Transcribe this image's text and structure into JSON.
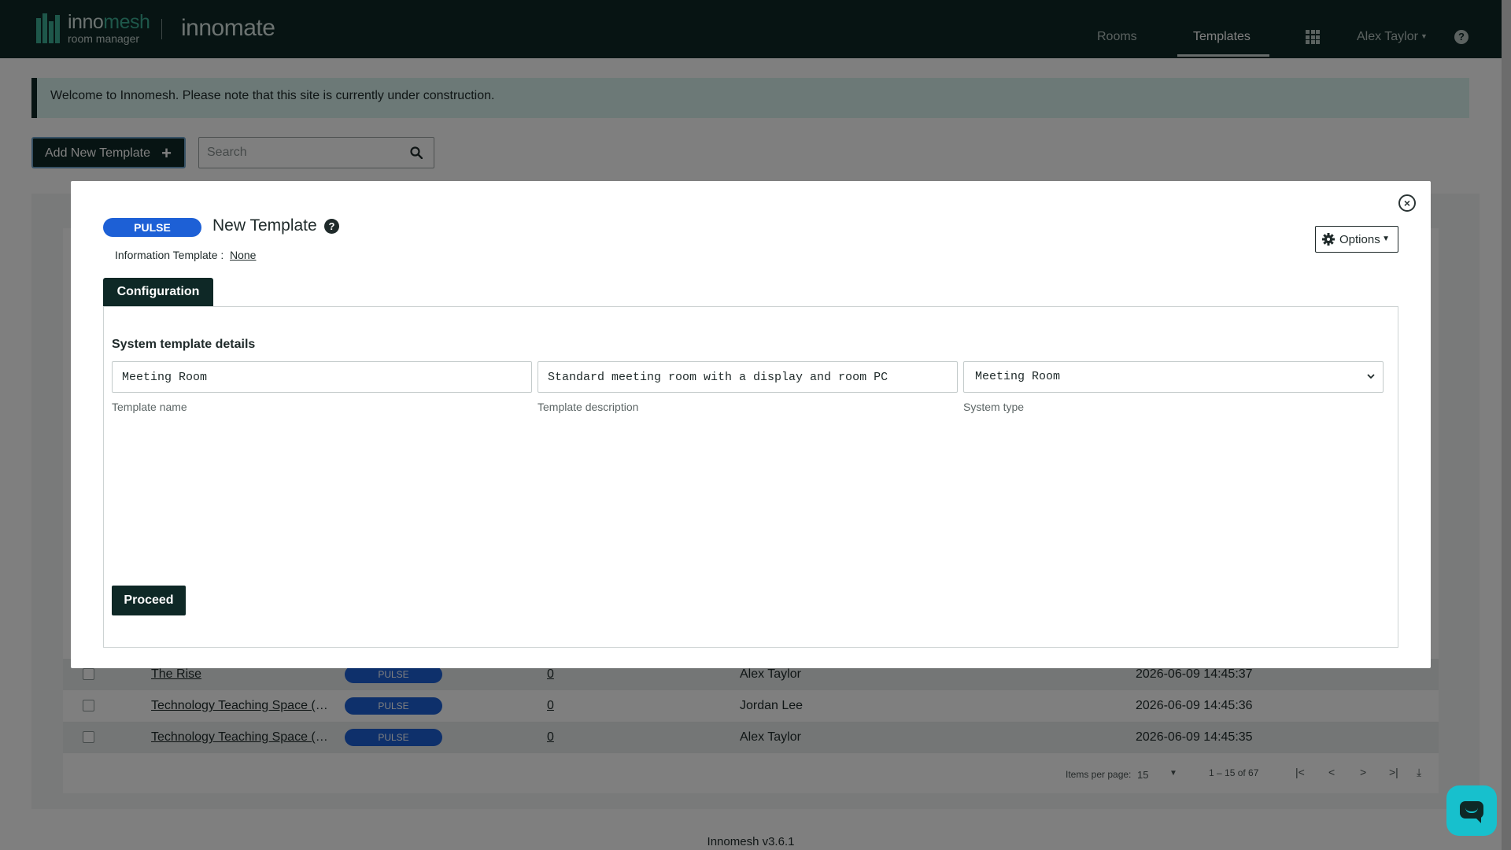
{
  "nav": {
    "brand_prefix": "inno",
    "brand_suffix": "mesh",
    "brand_sub": "room manager",
    "product": "innomate",
    "rooms": "Rooms",
    "templates": "Templates",
    "user": "Alex Taylor",
    "help_glyph": "?",
    "icons": [
      "apps-grid-icon",
      "help-icon",
      "caret-down-icon"
    ]
  },
  "alert": {
    "text": "Welcome to Innomesh. Please note that this site is currently under construction."
  },
  "toolbar": {
    "add_label": "Add New Template",
    "add_glyph": "+",
    "search_placeholder": "Search"
  },
  "table": {
    "rows": [
      {
        "name": "The Rise",
        "badge": "PULSE",
        "count": "0",
        "owner": "Alex Taylor",
        "date": "2026-06-09 14:45:37"
      },
      {
        "name": "Technology Teaching Space (Small)",
        "badge": "PULSE",
        "count": "0",
        "owner": "Jordan Lee",
        "date": "2026-06-09 14:45:36"
      },
      {
        "name": "Technology Teaching Space (Large)",
        "badge": "PULSE",
        "count": "0",
        "owner": "Alex Taylor",
        "date": "2026-06-09 14:45:35"
      }
    ]
  },
  "paginator": {
    "items_label": "Items per page:",
    "size": "15",
    "range": "1 – 15 of 67",
    "first": "|<",
    "prev": "<",
    "next": ">",
    "last": ">|",
    "download": "⤓"
  },
  "footer": {
    "version": "Innomesh v3.6.1"
  },
  "modal": {
    "close_glyph": "×",
    "badge": "PULSE",
    "title": "New Template",
    "help_glyph": "?",
    "info_label": "Information Template :",
    "info_value": "None",
    "options_label": "Options",
    "tab_label": "Configuration",
    "section_heading": "System template details",
    "fields": {
      "name_value": "Meeting Room",
      "name_label": "Template name",
      "description_value": "Standard meeting room with a display and room PC",
      "description_label": "Template description",
      "system_type_value": "Meeting Room",
      "system_type_label": "System type"
    },
    "proceed_label": "Proceed"
  },
  "colors": {
    "navbar": "#0e2826",
    "accent": "#3cae95",
    "badge": "#1d60d6",
    "chat": "#17c0cd"
  }
}
